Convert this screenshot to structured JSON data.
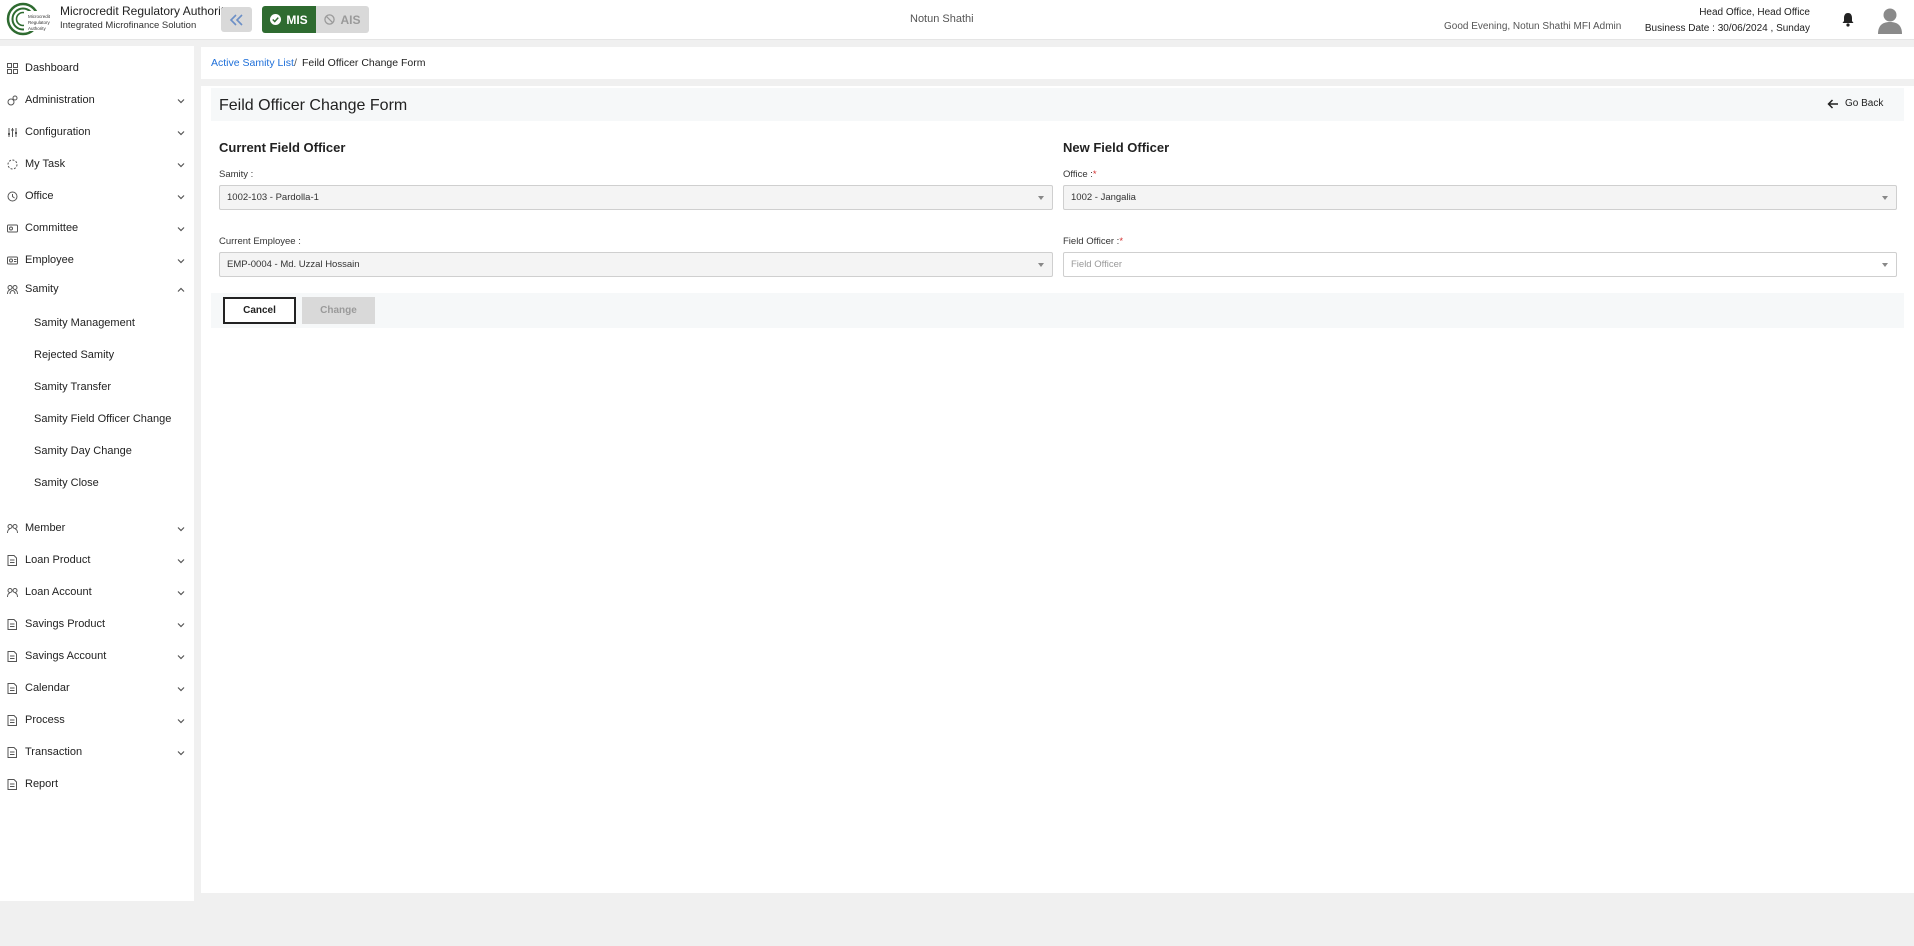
{
  "header": {
    "brand_title": "Microcredit Regulatory Authority",
    "brand_subtitle": "Integrated Microfinance Solution",
    "mode_mis": "MIS",
    "mode_ais": "AIS",
    "org_name": "Notun Shathi",
    "greeting": "Good Evening, Notun Shathi MFI Admin",
    "office": "Head Office, Head Office",
    "business_date": "Business Date : 30/06/2024 , Sunday",
    "accent_color": "#2e6b30"
  },
  "sidebar": {
    "items": [
      {
        "label": "Dashboard",
        "icon": "grid-icon"
      },
      {
        "label": "Administration",
        "icon": "admin-icon"
      },
      {
        "label": "Configuration",
        "icon": "sliders-icon"
      },
      {
        "label": "My Task",
        "icon": "task-icon"
      },
      {
        "label": "Office",
        "icon": "office-icon"
      },
      {
        "label": "Committee",
        "icon": "committee-icon"
      },
      {
        "label": "Employee",
        "icon": "employee-icon"
      },
      {
        "label": "Samity",
        "icon": "samity-icon"
      },
      {
        "label": "Member",
        "icon": "member-icon"
      },
      {
        "label": "Loan Product",
        "icon": "doc-icon"
      },
      {
        "label": "Loan Account",
        "icon": "account-icon"
      },
      {
        "label": "Savings Product",
        "icon": "doc-icon"
      },
      {
        "label": "Savings Account",
        "icon": "doc-icon"
      },
      {
        "label": "Calendar",
        "icon": "doc-icon"
      },
      {
        "label": "Process",
        "icon": "doc-icon"
      },
      {
        "label": "Transaction",
        "icon": "doc-icon"
      },
      {
        "label": "Report",
        "icon": "doc-icon"
      }
    ],
    "samity_sub": [
      "Samity Management",
      "Rejected Samity",
      "Samity Transfer",
      "Samity Field Officer Change",
      "Samity Day Change",
      "Samity Close"
    ]
  },
  "breadcrumb": {
    "link": "Active Samity List",
    "separator": "/",
    "current": "Feild Officer Change Form"
  },
  "form": {
    "title": "Feild Officer Change Form",
    "go_back": "Go Back",
    "current_section": "Current Field Officer",
    "new_section": "New Field Officer",
    "samity_label": "Samity :",
    "samity_value": "1002-103 - Pardolla-1",
    "employee_label": "Current Employee :",
    "employee_value": "EMP-0004 - Md. Uzzal Hossain",
    "office_label": "Office :",
    "office_value": "1002 - Jangalia",
    "field_officer_label": "Field Officer :",
    "field_officer_placeholder": "Field Officer",
    "required_mark": "*",
    "cancel": "Cancel",
    "change": "Change"
  }
}
